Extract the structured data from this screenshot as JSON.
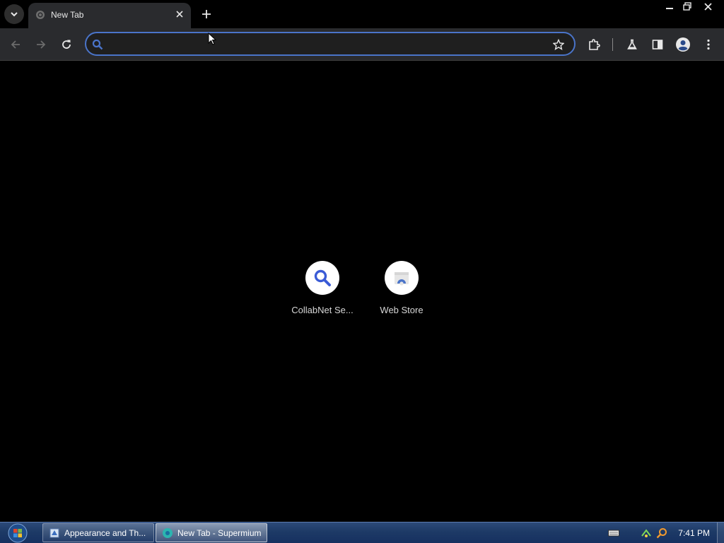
{
  "tabs": [
    {
      "title": "New Tab"
    }
  ],
  "omnibox": {
    "value": "",
    "placeholder": ""
  },
  "shortcuts": [
    {
      "label": "CollabNet Se...",
      "icon": "search-icon"
    },
    {
      "label": "Web Store",
      "icon": "web-store-icon"
    }
  ],
  "taskbar": {
    "buttons": [
      {
        "label": "Appearance and Th...",
        "icon": "control-panel-icon",
        "active": false
      },
      {
        "label": "New Tab - Supermium",
        "icon": "browser-icon",
        "active": true
      }
    ],
    "clock": "7:41 PM"
  },
  "colors": {
    "accent": "#4a74c9",
    "toolbar": "#2a2b2e",
    "background": "#000000"
  }
}
